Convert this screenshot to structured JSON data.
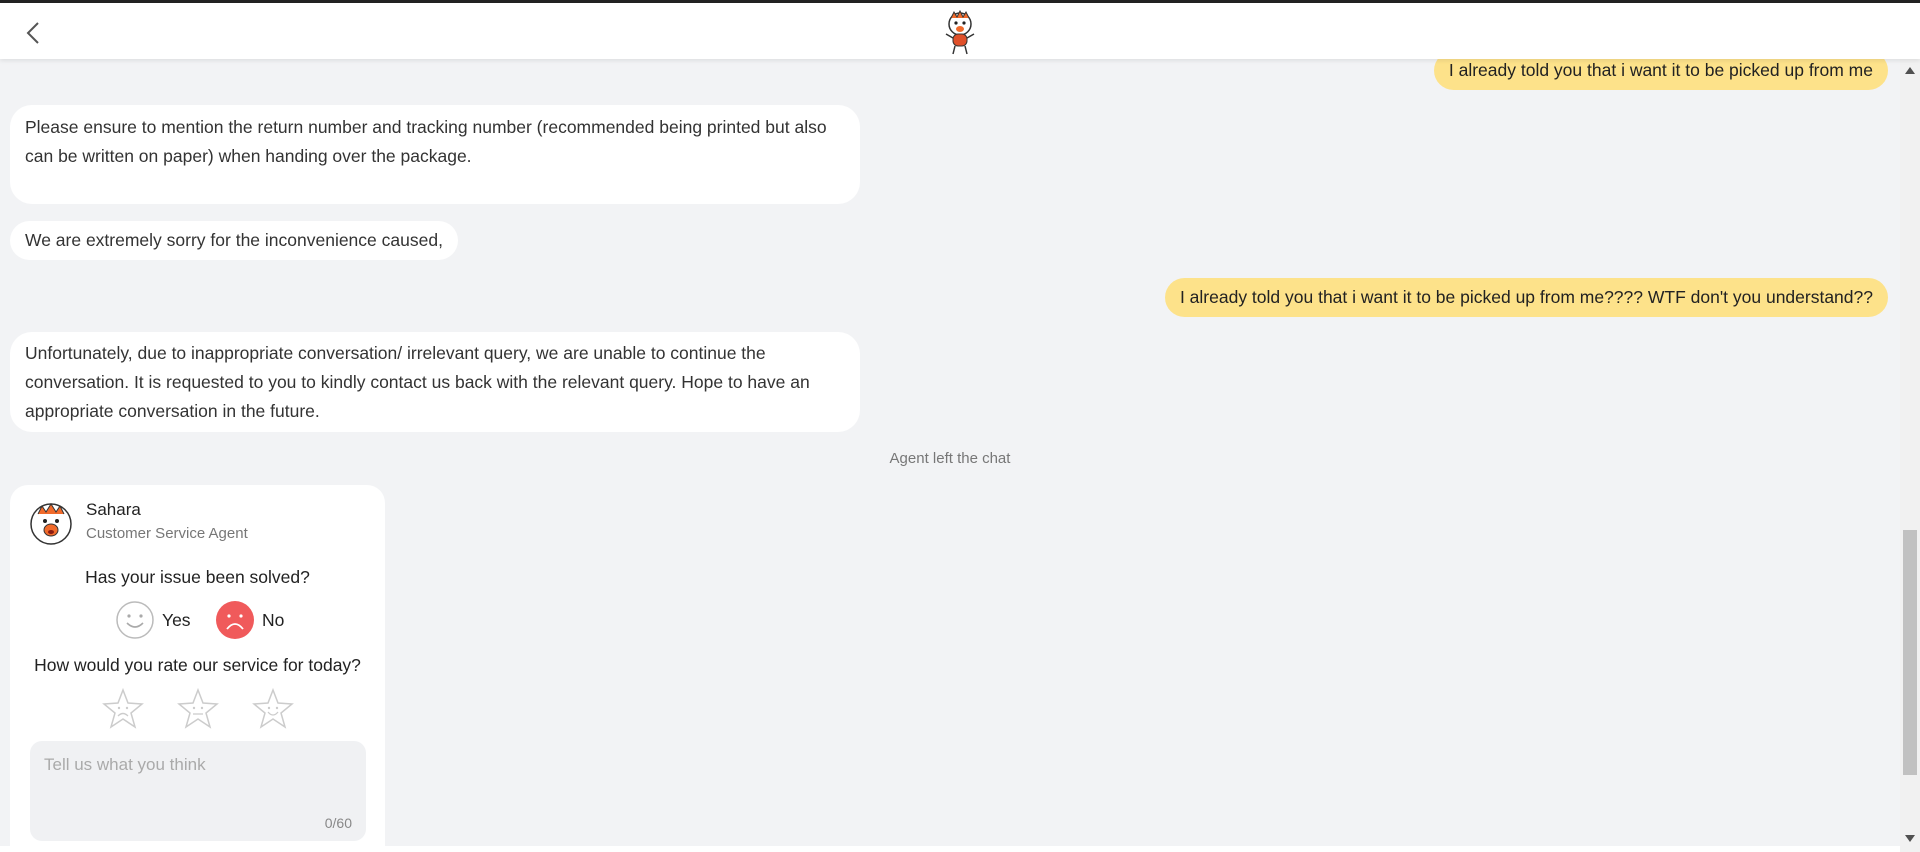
{
  "header": {
    "back_icon": "chevron-left-icon",
    "logo_icon": "mascot-logo-icon"
  },
  "messages": [
    {
      "sender": "user",
      "text": "I already told you that i want it to be picked up from me"
    },
    {
      "sender": "agent",
      "text": "Please ensure to mention the return number and tracking number (recommended being printed but also can be written on paper) when handing over the package."
    },
    {
      "sender": "agent",
      "text": "We are extremely sorry for the inconvenience caused,"
    },
    {
      "sender": "user",
      "text": "I already told you that i want it to be picked up from me???? WTF don't you understand??"
    },
    {
      "sender": "agent",
      "text": "Unfortunately, due to inappropriate conversation/ irrelevant query, we are unable to continue the conversation. It is requested to you to kindly contact us back with the relevant query. Hope to have an appropriate conversation in the future."
    }
  ],
  "system_note": "Agent left the chat",
  "survey": {
    "agent_name": "Sahara",
    "agent_role": "Customer Service Agent",
    "question_solved": "Has your issue been solved?",
    "yes_label": "Yes",
    "no_label": "No",
    "question_rating": "How would you rate our service for today?",
    "rating_icons": [
      "sad-star-icon",
      "neutral-star-icon",
      "happy-star-icon"
    ],
    "feedback_placeholder": "Tell us what you think",
    "feedback_counter": "0/60"
  },
  "colors": {
    "user_bubble": "#fde28a",
    "agent_bubble": "#ffffff",
    "background": "#f2f3f5",
    "no_accent": "#f05a5b"
  }
}
